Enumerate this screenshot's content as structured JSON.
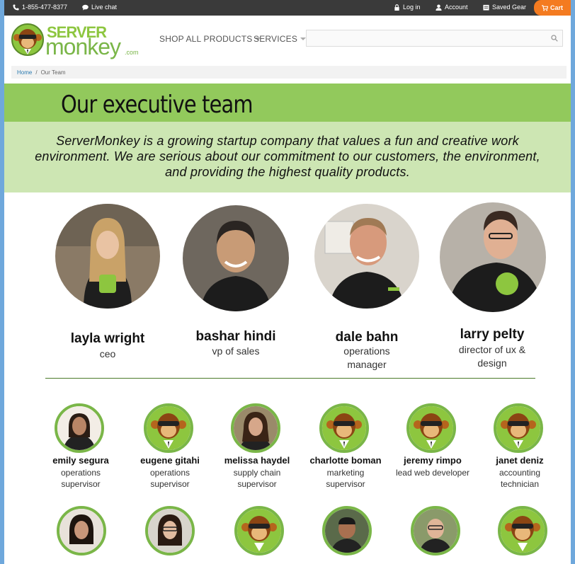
{
  "topbar": {
    "phone": "1-855-477-8377",
    "live_chat": "Live chat",
    "login": "Log in",
    "account": "Account",
    "saved_gear": "Saved Gear",
    "cart": "Cart"
  },
  "logo": {
    "line1": "SERVER",
    "line2": "monkey",
    "suffix": ".com"
  },
  "nav": {
    "shop": "SHOP ALL PRODUCTS",
    "services": "SERVICES"
  },
  "search": {
    "placeholder": ""
  },
  "breadcrumb": {
    "home": "Home",
    "separator": "/",
    "current": "Our Team"
  },
  "banner": {
    "title": "Our executive team"
  },
  "intro": "ServerMonkey is a growing startup company that values a fun and creative work environment. We are serious about our commitment to our customers, the environment, and providing the highest quality products.",
  "executives": [
    {
      "name": "layla wright",
      "title": "ceo"
    },
    {
      "name": "bashar hindi",
      "title": "vp of sales"
    },
    {
      "name": "dale bahn",
      "title": "operations manager"
    },
    {
      "name": "larry pelty",
      "title": "director of ux & design"
    }
  ],
  "staff": [
    {
      "name": "emily segura",
      "title": "operations supervisor",
      "photo": "person"
    },
    {
      "name": "eugene gitahi",
      "title": "operations supervisor",
      "photo": "monkey-icon"
    },
    {
      "name": "melissa haydel",
      "title": "supply chain supervisor",
      "photo": "person"
    },
    {
      "name": "charlotte boman",
      "title": "marketing supervisor",
      "photo": "monkey-icon"
    },
    {
      "name": "jeremy rimpo",
      "title": "lead web developer",
      "photo": "monkey-icon"
    },
    {
      "name": "janet deniz",
      "title": "accounting technician",
      "photo": "monkey-icon"
    }
  ],
  "colors": {
    "accent": "#f47b20",
    "brand_green": "#7ab648",
    "banner": "#92c95c",
    "intro_bg": "#cde6b3",
    "topbar": "#3a3a3a"
  }
}
